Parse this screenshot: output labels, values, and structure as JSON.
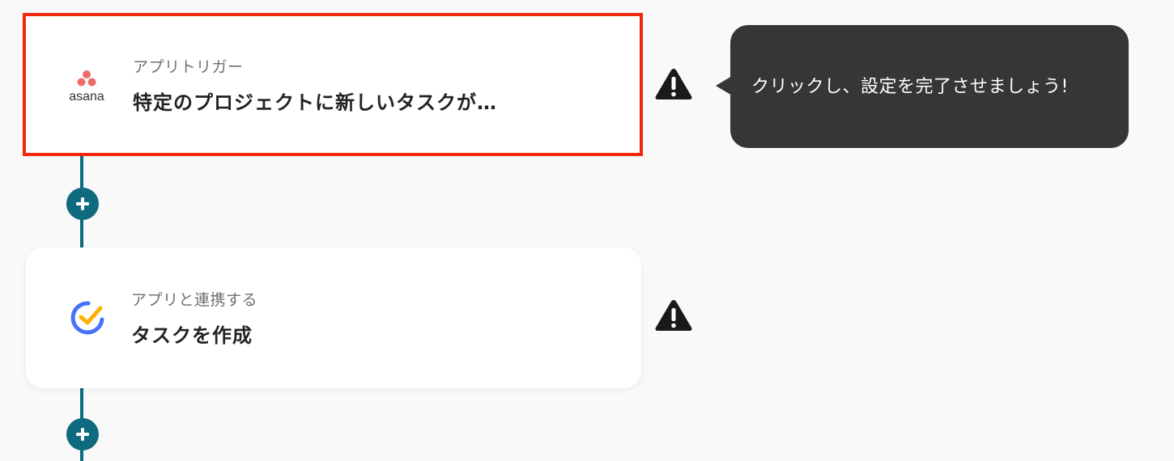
{
  "steps": [
    {
      "app": "asana",
      "app_logo_text": "asana",
      "subtitle": "アプリトリガー",
      "title": "特定のプロジェクトに新しいタスクが…",
      "selected": true,
      "warning": true
    },
    {
      "app": "ticktick",
      "subtitle": "アプリと連携する",
      "title": "タスクを作成",
      "selected": false,
      "warning": true
    }
  ],
  "tooltip": {
    "text": "クリックし、設定を完了させましょう!"
  },
  "colors": {
    "connector": "#0e6a7f",
    "selected_border": "#f0290d",
    "tooltip_bg": "#363636",
    "asana_pink": "#f06a6a",
    "ticktick_blue": "#4772fa",
    "ticktick_yellow": "#ffb000"
  },
  "icons": [
    "asana-logo",
    "ticktick-logo",
    "warning-icon",
    "plus-icon"
  ]
}
